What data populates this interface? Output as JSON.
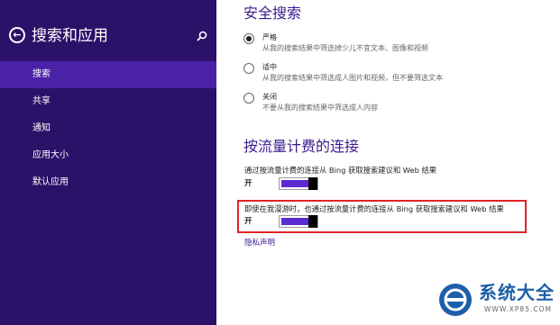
{
  "sidebar": {
    "title": "搜索和应用",
    "items": [
      {
        "label": "搜索",
        "active": true
      },
      {
        "label": "共享",
        "active": false
      },
      {
        "label": "通知",
        "active": false
      },
      {
        "label": "应用大小",
        "active": false
      },
      {
        "label": "默认应用",
        "active": false
      }
    ]
  },
  "safe_search": {
    "heading": "安全搜索",
    "options": [
      {
        "label": "严格",
        "desc": "从我的搜索结果中筛选掉少儿不宜文本、图像和视频",
        "checked": true
      },
      {
        "label": "适中",
        "desc": "从我的搜索结果中筛选成人图片和视频，但不要筛选文本",
        "checked": false
      },
      {
        "label": "关闭",
        "desc": "不要从我的搜索结果中筛选成人内容",
        "checked": false
      }
    ]
  },
  "metered": {
    "heading": "按流量计费的连接",
    "setting1_label": "通过按流量计费的连接从 Bing 获取搜索建议和 Web 结果",
    "setting1_state": "开",
    "setting2_label": "即使在我漫游时，也通过按流量计费的连接从 Bing 获取搜索建议和 Web 结果",
    "setting2_state": "开",
    "privacy_link": "隐私声明"
  },
  "watermark": {
    "text": "系统大全",
    "url": "WWW.XP85.COM"
  },
  "colors": {
    "sidebar_bg": "#2c1169",
    "active_item": "#4a22a8",
    "accent": "#3b1c8e",
    "toggle_on": "#5b2bd0",
    "highlight_box": "#e0232a"
  }
}
